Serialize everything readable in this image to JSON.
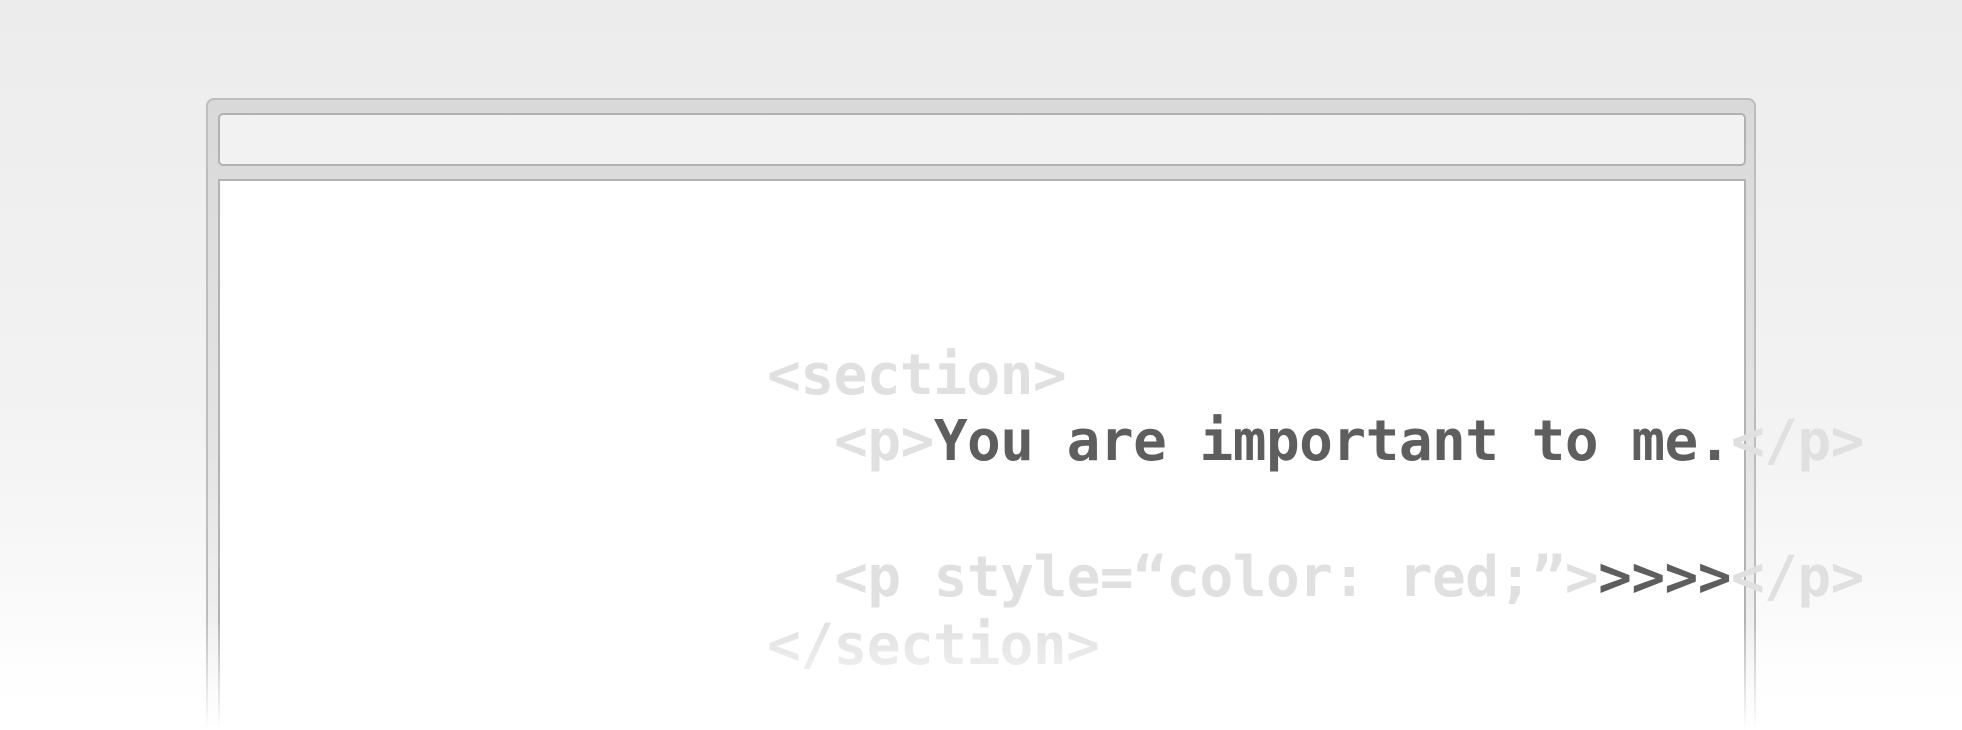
{
  "colors": {
    "tag_text": "#e0e0e0",
    "content_text": "#5e5e5e",
    "background": "#ececec",
    "window_frame": "#d9d9d9",
    "address_bar": "#f2f2f2",
    "viewport": "#ffffff"
  },
  "browser": {
    "address_bar_text": ""
  },
  "code": {
    "section_open": "<section>",
    "p_open": "<p>",
    "message": "You are important to me.",
    "p_close": "</p>",
    "styled_p_open": "<p style=“color: red;”>",
    "styled_content": ">>>>",
    "styled_p_close": "</p>",
    "section_close": "</section>"
  }
}
